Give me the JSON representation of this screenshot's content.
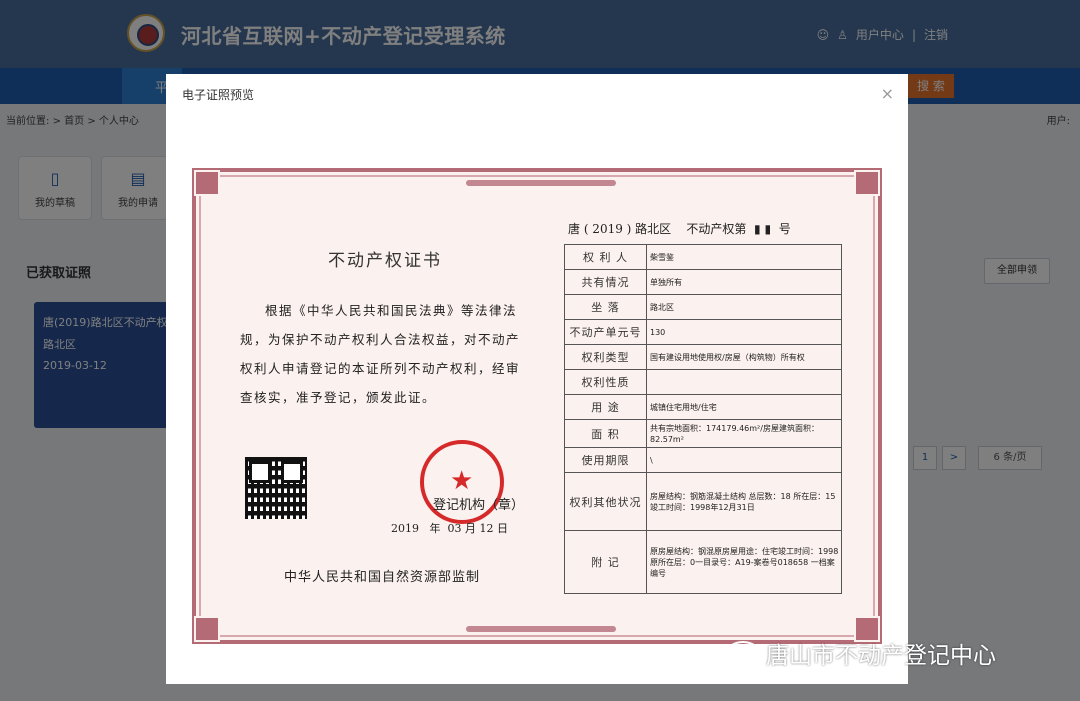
{
  "header": {
    "system_title": "河北省互联网+不动产登记受理系统",
    "user_center": "用户中心",
    "separator": "|",
    "logout": "注销"
  },
  "nav": {
    "active_tab": "平",
    "search_button": "搜 索"
  },
  "breadcrumb": {
    "label": "当前位置:",
    "sep1": ">",
    "home": "首页",
    "sep2": ">",
    "current": "个人中心"
  },
  "user_label": "用户:",
  "tiles": [
    {
      "label": "我的草稿"
    },
    {
      "label": "我的申请"
    }
  ],
  "section_title": "已获取证照",
  "all_apply_button": "全部申领",
  "card": {
    "title": "唐(2019)路北区不动产权",
    "address": "路北区",
    "date": "2019-03-12"
  },
  "pagination": {
    "page": "1",
    "next": ">",
    "page_size": "6 条/页"
  },
  "modal": {
    "title": "电子证照预览",
    "certificate": {
      "number_line": "唐 ( 2019 ) 路北区    不动产权第",
      "number_suffix": "号",
      "heading": "不动产权证书",
      "paragraph": "根据《中华人民共和国民法典》等法律法规，为保护不动产权利人合法权益，对不动产权利人申请登记的本证所列不动产权利，经审查核实，准予登记，颁发此证。",
      "registration_authority": "登记机构（章）",
      "date_line": "2019   年  03 月 12 日",
      "supervisor": "中华人民共和国自然资源部监制",
      "rows": [
        {
          "key": "权 利 人",
          "value": "柴雪鉴"
        },
        {
          "key": "共有情况",
          "value": "单独所有"
        },
        {
          "key": "坐    落",
          "value": "路北区"
        },
        {
          "key": "不动产单元号",
          "value": "130"
        },
        {
          "key": "权利类型",
          "value": "国有建设用地使用权/房屋（构筑物）所有权"
        },
        {
          "key": "权利性质",
          "value": ""
        },
        {
          "key": "用    途",
          "value": "城镇住宅用地/住宅"
        },
        {
          "key": "面    积",
          "value": "共有宗地面积：174179.46m²/房屋建筑面积：82.57m²"
        },
        {
          "key": "使用期限",
          "value": "\\"
        },
        {
          "key": "权利其他状况",
          "value": "房屋结构：钢筋混凝土结构 总层数：18 所在层：15 竣工时间：1998年12月31日"
        },
        {
          "key": "附    记",
          "value": "原房屋结构：钢混原房屋用途：住宅竣工时间：1998原所在层：0一目录号：A19-案卷号018658 一档案编号"
        }
      ]
    }
  },
  "watermark": "唐山市不动产登记中心"
}
